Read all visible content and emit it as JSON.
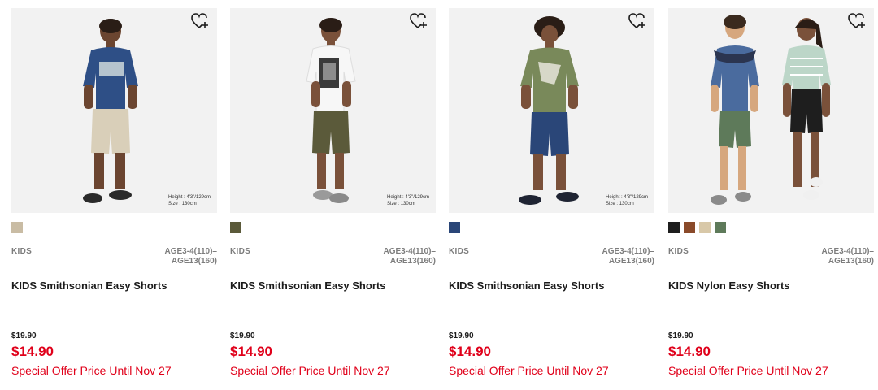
{
  "colors": {
    "accent_red": "#e0001a",
    "muted": "#7d7d7d",
    "photo_bg": "#f2f2f2"
  },
  "products": [
    {
      "gender": "KIDS",
      "sizes_line1": "AGE3-4(110)–",
      "sizes_line2": "AGE13(160)",
      "name": "KIDS Smithsonian Easy Shorts",
      "original_price": "$19.90",
      "price": "$14.90",
      "offer": "Special Offer Price Until Nov 27",
      "height_note_1": "Height : 4'3\"/129cm",
      "height_note_2": "Size : 130cm",
      "swatches": [
        "#c9bca4"
      ],
      "favorite_icon": "heart-plus-icon"
    },
    {
      "gender": "KIDS",
      "sizes_line1": "AGE3-4(110)–",
      "sizes_line2": "AGE13(160)",
      "name": "KIDS Smithsonian Easy Shorts",
      "original_price": "$19.90",
      "price": "$14.90",
      "offer": "Special Offer Price Until Nov 27",
      "height_note_1": "Height : 4'3\"/129cm",
      "height_note_2": "Size : 130cm",
      "swatches": [
        "#5b5a3a"
      ],
      "favorite_icon": "heart-plus-icon"
    },
    {
      "gender": "KIDS",
      "sizes_line1": "AGE3-4(110)–",
      "sizes_line2": "AGE13(160)",
      "name": "KIDS Smithsonian Easy Shorts",
      "original_price": "$19.90",
      "price": "$14.90",
      "offer": "Special Offer Price Until Nov 27",
      "height_note_1": "Height : 4'3\"/129cm",
      "height_note_2": "Size : 130cm",
      "swatches": [
        "#2a4678"
      ],
      "favorite_icon": "heart-plus-icon"
    },
    {
      "gender": "KIDS",
      "sizes_line1": "AGE3-4(110)–",
      "sizes_line2": "AGE13(160)",
      "name": "KIDS Nylon Easy Shorts",
      "original_price": "$19.90",
      "price": "$14.90",
      "offer": "Special Offer Price Until Nov 27",
      "swatches": [
        "#1e1e1e",
        "#8a4a2a",
        "#d8c8a8",
        "#5e7a5a"
      ],
      "favorite_icon": "heart-plus-icon"
    }
  ]
}
